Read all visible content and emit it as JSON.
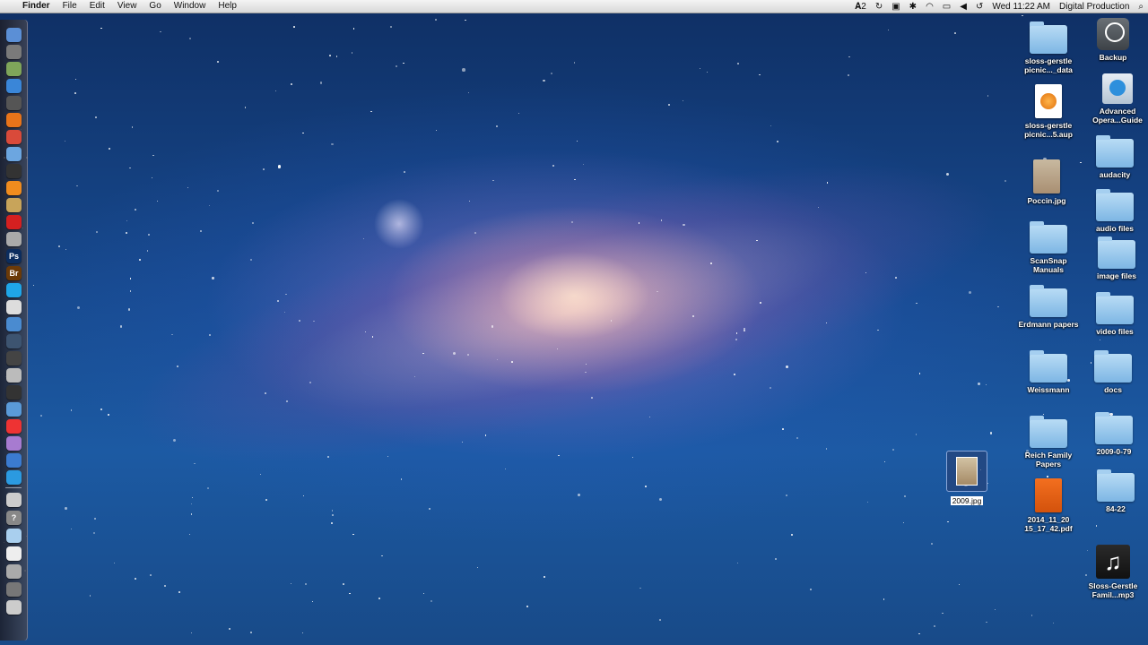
{
  "menubar": {
    "app_name": "Finder",
    "menus": [
      "File",
      "Edit",
      "View",
      "Go",
      "Window",
      "Help"
    ],
    "status": {
      "adobe_count": "2",
      "clock": "Wed 11:22 AM",
      "user": "Digital Production"
    }
  },
  "dock": {
    "icons": [
      "finder-icon",
      "dashboard-icon",
      "preview-icon",
      "safari-icon",
      "itunes-icon",
      "firefox-icon",
      "chrome-icon",
      "mail-icon",
      "imovie-icon",
      "vlc-icon",
      "photos-icon",
      "acrobat-icon",
      "fetch-icon",
      "photoshop-icon",
      "bridge-icon",
      "skype-icon",
      "stamp-icon",
      "screensnap-icon",
      "timemachine-icon",
      "photobooth-icon",
      "audio-icon",
      "facetime-icon",
      "network-icon",
      "pdf-icon",
      "instrument-icon",
      "globe-icon",
      "safari-alt-icon",
      "install-icon",
      "help-icon",
      "folder-icon",
      "doc-stack-icon",
      "downloads-icon",
      "cabinet-icon",
      "trash-icon"
    ]
  },
  "desktop": {
    "right_column_1": [
      {
        "label": "sloss-gerstle picnic..._data",
        "kind": "folder"
      },
      {
        "label": "sloss-gerstle picnic...5.aup",
        "kind": "audacity-doc"
      },
      {
        "label": "Poccin.jpg",
        "kind": "image"
      },
      {
        "label": "ScanSnap Manuals",
        "kind": "folder"
      },
      {
        "label": "Erdmann papers",
        "kind": "folder"
      },
      {
        "label": "Weissmann",
        "kind": "folder"
      },
      {
        "label": "Reich Family Papers",
        "kind": "folder"
      },
      {
        "label": "2014_11_20 15_17_42.pdf",
        "kind": "pdf"
      }
    ],
    "right_column_2": [
      {
        "label": "Backup",
        "kind": "timemachine-drive"
      },
      {
        "label": "Advanced Opera...Guide",
        "kind": "app-doc"
      },
      {
        "label": "audacity",
        "kind": "folder"
      },
      {
        "label": "audio files",
        "kind": "folder"
      },
      {
        "label": "image files",
        "kind": "folder"
      },
      {
        "label": "video files",
        "kind": "folder"
      },
      {
        "label": "docs",
        "kind": "folder"
      },
      {
        "label": "2009-0-79",
        "kind": "folder"
      },
      {
        "label": "84-22",
        "kind": "folder"
      },
      {
        "label": "Sloss-Gerstle Famil...mp3",
        "kind": "music"
      }
    ],
    "selected_item": {
      "label": "2009.jpg",
      "kind": "image",
      "renaming": true
    }
  },
  "colors": {
    "folder": "#8fc3ec",
    "menubar": "#e4e4e4",
    "selection": "#3b5b94"
  }
}
